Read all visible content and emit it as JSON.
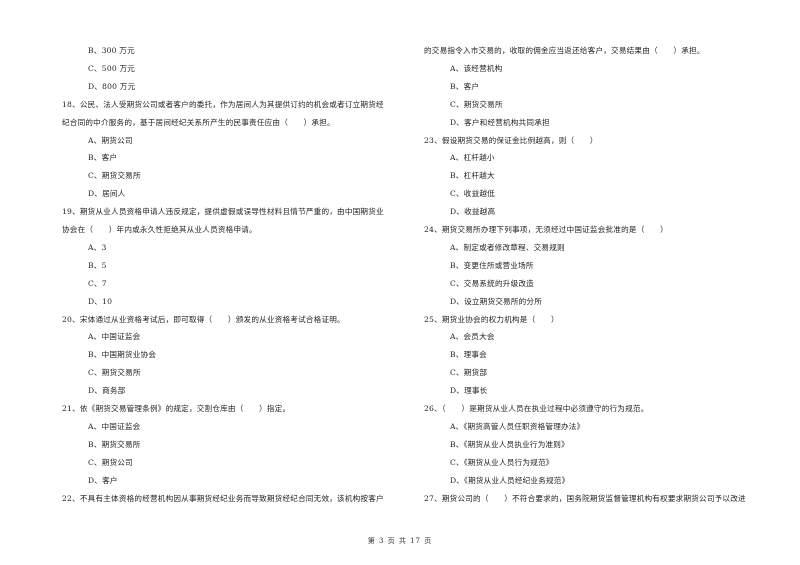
{
  "left_column": [
    {
      "type": "option",
      "text": "B、300 万元"
    },
    {
      "type": "option",
      "text": "C、500 万元"
    },
    {
      "type": "option",
      "text": "D、800 万元"
    },
    {
      "type": "question",
      "text": "18、公民、法人受期货公司或者客户的委托，作为居间人为其提供订约的机会或者订立期货经"
    },
    {
      "type": "question-cont",
      "text": "纪合同的中介服务的，基于居间经纪关系所产生的民事责任应由（　　）承担。"
    },
    {
      "type": "option",
      "text": "A、期货公司"
    },
    {
      "type": "option",
      "text": "B、客户"
    },
    {
      "type": "option",
      "text": "C、期货交易所"
    },
    {
      "type": "option",
      "text": "D、居间人"
    },
    {
      "type": "question",
      "text": "19、期货从业人员资格申请人违反规定，提供虚假或误导性材料且情节严重的，由中国期货业"
    },
    {
      "type": "question-cont",
      "text": "协会在（　　）年内或永久性拒绝其从业人员资格申请。"
    },
    {
      "type": "option",
      "text": "A、3"
    },
    {
      "type": "option",
      "text": "B、5"
    },
    {
      "type": "option",
      "text": "C、7"
    },
    {
      "type": "option",
      "text": "D、10"
    },
    {
      "type": "question",
      "text": "20、宋体通过从业资格考试后，即可取得（　　）颁发的从业资格考试合格证明。"
    },
    {
      "type": "option",
      "text": "A、中国证监会"
    },
    {
      "type": "option",
      "text": "B、中国期货业协会"
    },
    {
      "type": "option",
      "text": "C、期货交易所"
    },
    {
      "type": "option",
      "text": "D、商务部"
    },
    {
      "type": "question",
      "text": "21、依《期货交易管理条例》的规定，交割仓库由（　　）指定。"
    },
    {
      "type": "option",
      "text": "A、中国证监会"
    },
    {
      "type": "option",
      "text": "B、期货交易所"
    },
    {
      "type": "option",
      "text": "C、期货公司"
    },
    {
      "type": "option",
      "text": "D、客户"
    },
    {
      "type": "question",
      "text": "22、不具有主体资格的经营机构因从事期货经纪业务而导致期货经纪合同无效，该机构按客户"
    }
  ],
  "right_column": [
    {
      "type": "question-cont",
      "text": "的交易指令入市交易的，收取的佣金应当返还给客户，交易结果由（　　）承担。"
    },
    {
      "type": "option",
      "text": "A、该经营机构"
    },
    {
      "type": "option",
      "text": "B、客户"
    },
    {
      "type": "option",
      "text": "C、期货交易所"
    },
    {
      "type": "option",
      "text": "D、客户和经营机构共同承担"
    },
    {
      "type": "question",
      "text": "23、假设期货交易的保证金比例越高，则（　　）"
    },
    {
      "type": "option",
      "text": "A、杠杆越小"
    },
    {
      "type": "option",
      "text": "B、杠杆越大"
    },
    {
      "type": "option",
      "text": "C、收益越低"
    },
    {
      "type": "option",
      "text": "D、收益越高"
    },
    {
      "type": "question",
      "text": "24、期货交易所办理下列事项，无须经过中国证监会批准的是（　　）"
    },
    {
      "type": "option",
      "text": "A、制定或者修改章程、交易规则"
    },
    {
      "type": "option",
      "text": "B、变更住所或营业场所"
    },
    {
      "type": "option",
      "text": "C、交易系统的升级改造"
    },
    {
      "type": "option",
      "text": "D、设立期货交易所的分所"
    },
    {
      "type": "question",
      "text": "25、期货业协会的权力机构是（　　）"
    },
    {
      "type": "option",
      "text": "A、会员大会"
    },
    {
      "type": "option",
      "text": "B、理事会"
    },
    {
      "type": "option",
      "text": "C、期货部"
    },
    {
      "type": "option",
      "text": "D、理事长"
    },
    {
      "type": "question",
      "text": "26、（　　）是期货从业人员在执业过程中必须遵守的行为规范。"
    },
    {
      "type": "option",
      "text": "A、《期货高管人员任职资格管理办法》"
    },
    {
      "type": "option",
      "text": "B、《期货从业人员执业行为准则》"
    },
    {
      "type": "option",
      "text": "C、《期货从业人员行为规范》"
    },
    {
      "type": "option",
      "text": "D、《期货从业人员经纪业务规范》"
    },
    {
      "type": "question",
      "text": "27、期货公司的（　　）不符合要求的，国务院期货监督管理机构有权要求期货公司予以改进"
    }
  ],
  "footer": {
    "page_label": "第 3 页 共 17 页"
  }
}
